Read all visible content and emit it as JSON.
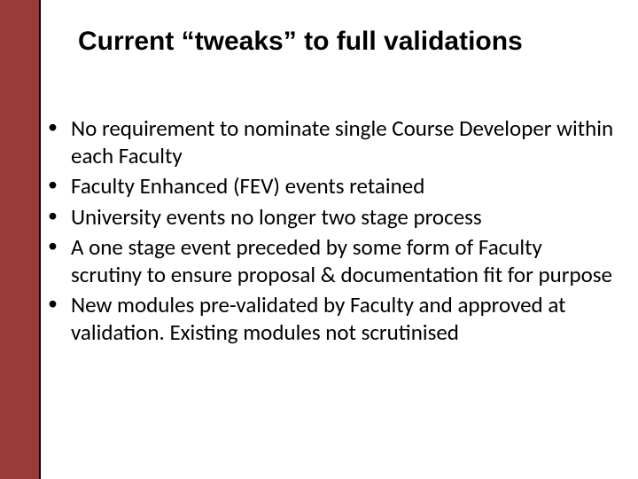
{
  "slide": {
    "title": "Current “tweaks” to full validations",
    "bullets": [
      "No requirement to nominate single Course Developer within each Faculty",
      "Faculty Enhanced (FEV) events retained",
      "University events no longer two stage process",
      "A one stage event preceded by some form of Faculty scrutiny to ensure proposal & documentation fit for purpose",
      "New modules pre-validated by Faculty and approved at validation. Existing modules not scrutinised"
    ]
  },
  "accent_color": "#9a3b3b"
}
